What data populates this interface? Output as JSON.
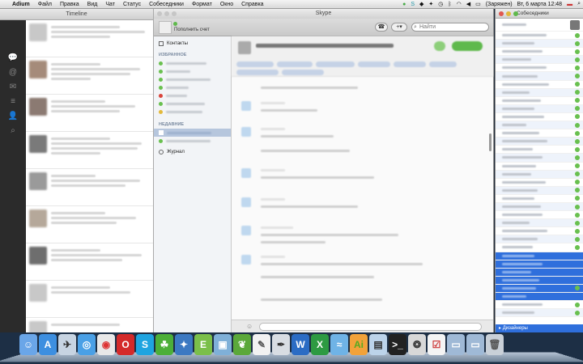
{
  "menubar": {
    "app": "Adium",
    "items": [
      "Файл",
      "Правка",
      "Вид",
      "Чат",
      "Статус",
      "Собеседники",
      "Формат",
      "Окно",
      "Справка"
    ],
    "battery": "(Заряжен)",
    "clock": "Вт, 6 марта 12:48"
  },
  "timeline": {
    "title": "Timeline"
  },
  "skype": {
    "title": "Skype",
    "account_label": "Пополнить счет",
    "search_placeholder": "Найти",
    "sidebar": {
      "contacts": "Контакты",
      "favorites_header": "ИЗБРАННОЕ",
      "recent_header": "НЕДАВНИЕ",
      "history": "Журнал"
    }
  },
  "contacts_window": {
    "title": "Собеседники",
    "footer_group": "Дизайнеры"
  },
  "colors": {
    "accent": "#2f6fdc",
    "online": "#69c04f",
    "busy": "#d9443b",
    "away": "#e3b93a"
  }
}
